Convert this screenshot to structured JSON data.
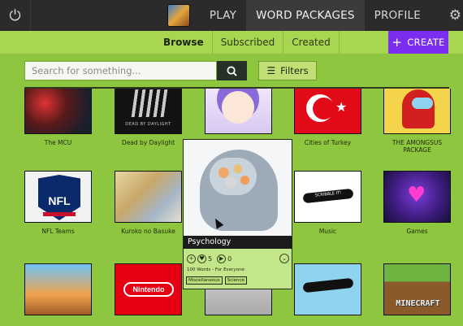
{
  "topbar": {
    "power_icon": "power-icon",
    "nav": [
      "PLAY",
      "WORD PACKAGES",
      "PROFILE"
    ],
    "active_nav": "WORD PACKAGES",
    "settings_icon": "gear-icon"
  },
  "subnav": {
    "tabs": [
      "Browse",
      "Subscribed",
      "Created"
    ],
    "active_tab": "Browse",
    "create_label": "CREATE"
  },
  "search": {
    "placeholder": "Search for something...",
    "value": "",
    "filters_label": "Filters"
  },
  "packages": [
    {
      "name": "The MCU"
    },
    {
      "name": "Dead by Daylight"
    },
    {
      "name": ""
    },
    {
      "name": "Cities of Turkey"
    },
    {
      "name": "THE AMONGSUS PACKAGE"
    },
    {
      "name": "NFL Teams"
    },
    {
      "name": "Kuroko no Basuke"
    },
    {
      "name": "Music"
    },
    {
      "name": "Games"
    },
    {
      "name": ""
    },
    {
      "name": ""
    },
    {
      "name": ""
    },
    {
      "name": ""
    },
    {
      "name": ""
    }
  ],
  "popup": {
    "title": "Psychology",
    "likes": "5",
    "plays": "0",
    "meta": "100 Words - For Everyone",
    "tags": [
      "Miscellaneous",
      "Science"
    ]
  },
  "thumb_text": {
    "dbd": "DEAD BY DAYLIGHT",
    "nfl": "NFL",
    "music": "SCRIBBLE IT!",
    "nintendo": "Nintendo",
    "minecraft": "MINECRAFT"
  },
  "colors": {
    "background": "#8fc63f",
    "nav_bg": "#2b2b2b",
    "create_button": "#7b2df0"
  }
}
